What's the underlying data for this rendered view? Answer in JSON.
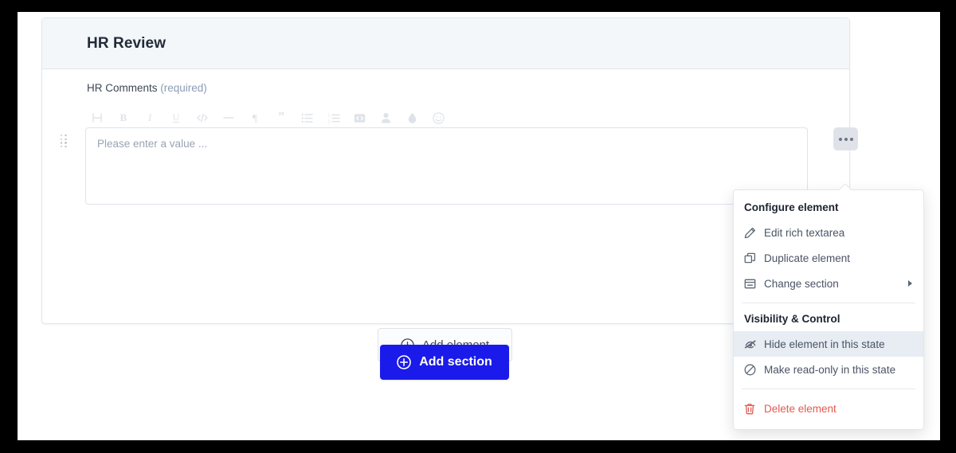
{
  "section": {
    "title": "HR Review",
    "field": {
      "label": "HR Comments",
      "required_text": "(required)",
      "placeholder": "Please enter a value ...",
      "value": ""
    },
    "toolbar": {
      "items": [
        {
          "name": "heading-icon",
          "glyph": "H"
        },
        {
          "name": "bold-icon",
          "glyph": "B"
        },
        {
          "name": "italic-icon",
          "glyph": "I"
        },
        {
          "name": "underline-icon",
          "glyph": "U"
        },
        {
          "name": "code-icon",
          "glyph": "</>"
        },
        {
          "name": "horizontal-rule-icon",
          "glyph": "—"
        },
        {
          "name": "paragraph-icon",
          "glyph": "¶"
        },
        {
          "name": "blockquote-icon",
          "glyph": "”"
        },
        {
          "name": "bullet-list-icon",
          "glyph": "list"
        },
        {
          "name": "numbered-list-icon",
          "glyph": "numlist"
        },
        {
          "name": "embed-code-icon",
          "glyph": "embed"
        },
        {
          "name": "user-mention-icon",
          "glyph": "user"
        },
        {
          "name": "color-droplet-icon",
          "glyph": "droplet"
        },
        {
          "name": "emoji-icon",
          "glyph": "smiley"
        }
      ]
    },
    "more_options_button": "•••",
    "add_element_label": "Add element"
  },
  "add_section_label": "Add section",
  "context_menu": {
    "groups": [
      {
        "title": "Configure element",
        "items": [
          {
            "label": "Edit rich textarea",
            "icon": "pencil-icon",
            "highlight": false,
            "danger": false,
            "submenu": false
          },
          {
            "label": "Duplicate element",
            "icon": "duplicate-icon",
            "highlight": false,
            "danger": false,
            "submenu": false
          },
          {
            "label": "Change section",
            "icon": "section-icon",
            "highlight": false,
            "danger": false,
            "submenu": true
          }
        ]
      },
      {
        "title": "Visibility & Control",
        "items": [
          {
            "label": "Hide element in this state",
            "icon": "eye-off-icon",
            "highlight": true,
            "danger": false,
            "submenu": false
          },
          {
            "label": "Make read-only in this state",
            "icon": "no-entry-icon",
            "highlight": false,
            "danger": false,
            "submenu": false
          }
        ]
      },
      {
        "title": "",
        "items": [
          {
            "label": "Delete element",
            "icon": "trash-icon",
            "highlight": false,
            "danger": true,
            "submenu": false
          }
        ]
      }
    ]
  },
  "colors": {
    "accent_blue": "#1a1aea",
    "section_header_bg": "#f4f7fa",
    "danger_red": "#e25b52",
    "highlight_bg": "#e7edf3",
    "muted_text": "#8b9bb4"
  }
}
